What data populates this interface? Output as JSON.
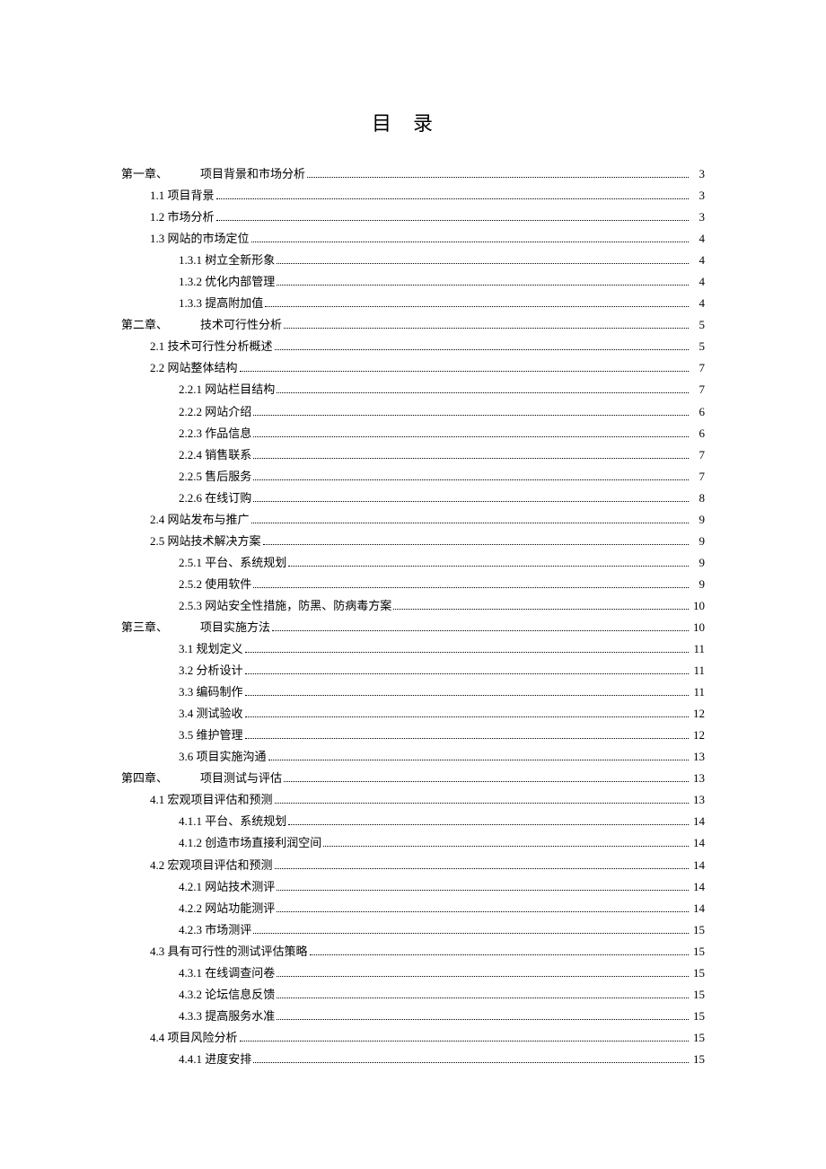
{
  "title": "目录",
  "entries": [
    {
      "level": 0,
      "prefix": "第一章、",
      "label": "项目背景和市场分析",
      "page": "3"
    },
    {
      "level": 1,
      "label": "1.1 项目背景",
      "page": "3"
    },
    {
      "level": 1,
      "label": "1.2 市场分析",
      "page": "3"
    },
    {
      "level": 1,
      "label": "1.3 网站的市场定位",
      "page": "4"
    },
    {
      "level": 2,
      "label": "1.3.1 树立全新形象",
      "page": "4"
    },
    {
      "level": 2,
      "label": "1.3.2 优化内部管理",
      "page": "4"
    },
    {
      "level": 2,
      "label": "1.3.3 提高附加值",
      "page": "4"
    },
    {
      "level": 0,
      "prefix": "第二章、",
      "label": "技术可行性分析",
      "page": "5"
    },
    {
      "level": 1,
      "label": "2.1 技术可行性分析概述",
      "page": "5"
    },
    {
      "level": 1,
      "label": "2.2 网站整体结构",
      "page": "7"
    },
    {
      "level": 2,
      "label": "2.2.1 网站栏目结构",
      "page": "7"
    },
    {
      "level": 2,
      "label": "2.2.2 网站介绍",
      "page": "6"
    },
    {
      "level": 2,
      "label": "2.2.3  作品信息",
      "page": "6"
    },
    {
      "level": 2,
      "label": "2.2.4  销售联系",
      "page": "7"
    },
    {
      "level": 2,
      "label": "2.2.5  售后服务",
      "page": "7"
    },
    {
      "level": 2,
      "label": "2.2.6  在线订购",
      "page": "8"
    },
    {
      "level": 1,
      "label": "2.4 网站发布与推广",
      "page": "9"
    },
    {
      "level": 1,
      "label": "2.5 网站技术解决方案",
      "page": "9"
    },
    {
      "level": 2,
      "label": "2.5.1 平台、系统规划",
      "page": "9"
    },
    {
      "level": 2,
      "label": "2.5.2 使用软件",
      "page": "9"
    },
    {
      "level": 2,
      "label": "2.5.3 网站安全性措施，防黑、防病毒方案",
      "page": "10"
    },
    {
      "level": 0,
      "prefix": "第三章、",
      "label": "项目实施方法",
      "page": "10"
    },
    {
      "level": 2,
      "label": "3.1 规划定义",
      "page": "11"
    },
    {
      "level": 2,
      "label": "3.2 分析设计",
      "page": "11"
    },
    {
      "level": 2,
      "label": "3.3 编码制作",
      "page": "11"
    },
    {
      "level": 2,
      "label": "3.4  测试验收",
      "page": "12"
    },
    {
      "level": 2,
      "label": "3.5 维护管理",
      "page": "12"
    },
    {
      "level": 2,
      "label": "3.6  项目实施沟通",
      "page": "13"
    },
    {
      "level": 0,
      "prefix": "第四章、",
      "label": "项目测试与评估",
      "page": "13"
    },
    {
      "level": 1,
      "label": "4.1 宏观项目评估和预测",
      "page": "13"
    },
    {
      "level": 2,
      "label": "4.1.1 平台、系统规划",
      "page": "14"
    },
    {
      "level": 2,
      "label": "4.1.2 创造市场直接利润空间",
      "page": "14"
    },
    {
      "level": 1,
      "label": "4.2 宏观项目评估和预测",
      "page": "14"
    },
    {
      "level": 2,
      "label": "4.2.1 网站技术测评",
      "page": "14"
    },
    {
      "level": 2,
      "label": "4.2.2 网站功能测评",
      "page": "14"
    },
    {
      "level": 2,
      "label": "4.2.3 市场测评",
      "page": "15"
    },
    {
      "level": 1,
      "label": "4.3 具有可行性的测试评估策略",
      "page": "15"
    },
    {
      "level": 2,
      "label": "4.3.1 在线调查问卷",
      "page": "15"
    },
    {
      "level": 2,
      "label": "4.3.2 论坛信息反馈",
      "page": "15"
    },
    {
      "level": 2,
      "label": "4.3.3 提高服务水准",
      "page": "15"
    },
    {
      "level": 1,
      "label": "4.4 项目风险分析",
      "page": "15"
    },
    {
      "level": 2,
      "label": "4.4.1 进度安排",
      "page": "15"
    }
  ]
}
